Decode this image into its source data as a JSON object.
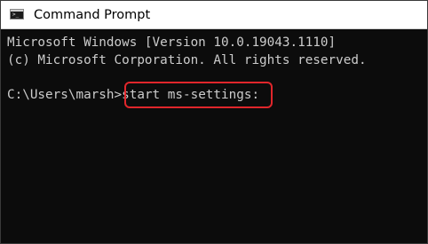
{
  "window": {
    "title": "Command Prompt",
    "icon": "cmd-icon"
  },
  "console": {
    "lines": [
      "Microsoft Windows [Version 10.0.19043.1110]",
      "(c) Microsoft Corporation. All rights reserved."
    ],
    "prompt": "C:\\Users\\marsh>",
    "command": "start ms-settings:"
  },
  "colors": {
    "console_background": "#0c0c0c",
    "console_text": "#cccccc",
    "highlight": "#e0262b"
  }
}
